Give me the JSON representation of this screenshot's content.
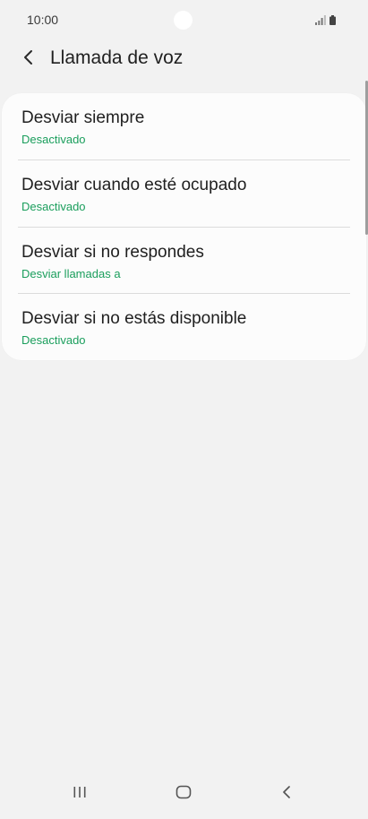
{
  "status_bar": {
    "time": "10:00",
    "icons": [
      "signal-icon",
      "battery-icon"
    ]
  },
  "header": {
    "title": "Llamada de voz",
    "back_icon": "chevron-left-icon"
  },
  "options": [
    {
      "title": "Desviar siempre",
      "subtitle": "Desactivado"
    },
    {
      "title": "Desviar cuando esté ocupado",
      "subtitle": "Desactivado"
    },
    {
      "title": "Desviar si no respondes",
      "subtitle": "Desviar llamadas a"
    },
    {
      "title": "Desviar si no estás disponible",
      "subtitle": "Desactivado"
    }
  ],
  "navigation": {
    "recents_icon": "recent-apps-icon",
    "home_icon": "home-icon",
    "back_icon": "back-icon"
  },
  "colors": {
    "background": "#f2f2f2",
    "card": "#fcfcfc",
    "accent_green": "#1a9e5c",
    "text_primary": "#1f1f1f"
  }
}
